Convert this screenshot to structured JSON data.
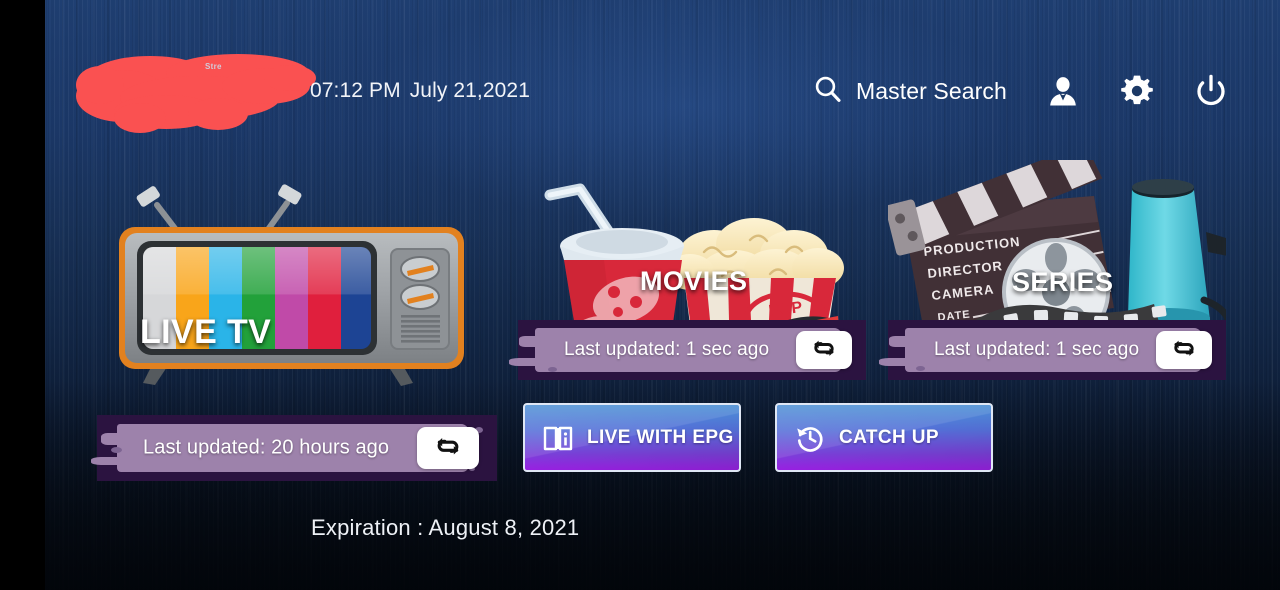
{
  "header": {
    "logo_alt": "channel-logo-redacted",
    "logo_ghost_text": "Stre",
    "time": "07:12 PM",
    "date": "July 21,2021",
    "master_search_label": "Master Search",
    "search_icon": "search-icon",
    "user_icon": "user-account-icon",
    "settings_icon": "gear-icon",
    "power_icon": "power-icon"
  },
  "tiles": {
    "live_tv": {
      "caption": "LIVE TV",
      "art": "retro-television-illustration",
      "last_updated": "Last updated: 20 hours ago",
      "refresh_icon": "repeat-refresh-icon"
    },
    "movies": {
      "caption": "MOVIES",
      "art": "popcorn-soda-3d-glasses-illustration",
      "art_text": "POP CORN",
      "last_updated": "Last updated: 1 sec ago",
      "refresh_icon": "repeat-refresh-icon"
    },
    "series": {
      "caption": "SERIES",
      "art": "clapperboard-film-reel-megaphone-illustration",
      "clapper_lines": [
        "PRODUCTION",
        "DIRECTOR",
        "CAMERA",
        "DATE"
      ],
      "last_updated": "Last updated: 1 sec ago",
      "refresh_icon": "repeat-refresh-icon"
    }
  },
  "buttons": {
    "epg": {
      "label": "LIVE WITH EPG",
      "icon": "book-info-icon"
    },
    "catch_up": {
      "label": "CATCH UP",
      "icon": "history-clock-icon"
    }
  },
  "footer": {
    "expiration": "Expiration : August 8, 2021"
  },
  "colors": {
    "bg_top": "#1f3f72",
    "bg_bottom": "#050b14",
    "bar_outer": "#2b1340",
    "bar_inner": "#9d82ab",
    "button_top": "#4a8fd4",
    "button_bottom": "#9b21e6",
    "redaction": "#fa5151"
  }
}
